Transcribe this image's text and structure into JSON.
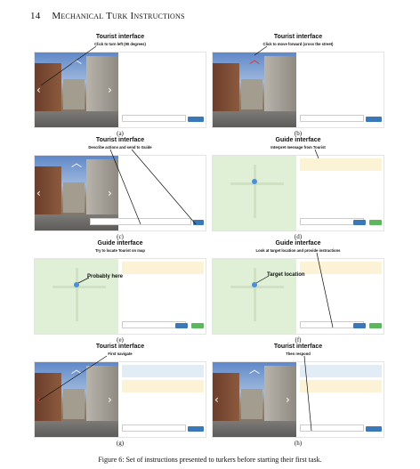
{
  "header": {
    "page_number": "14",
    "title": "Mechanical Turk Instructions"
  },
  "panels": [
    {
      "title": "Tourist interface",
      "subtitle": "Click to turn left (90 degrees)",
      "caption": "(a)"
    },
    {
      "title": "Tourist interface",
      "subtitle": "Click to move forward (cross the street)",
      "caption": "(b)"
    },
    {
      "title": "Tourist interface",
      "subtitle": "Describe actions and send to Guide",
      "caption": "(c)"
    },
    {
      "title": "Guide interface",
      "subtitle": "Interpret message from Tourist",
      "caption": "(d)"
    },
    {
      "title": "Guide interface",
      "subtitle": "Try to locate Tourist on map",
      "caption": "(e)",
      "note": "Probably here"
    },
    {
      "title": "Guide interface",
      "subtitle": "Look at target location and provide instructions",
      "caption": "(f)",
      "note": "Target location"
    },
    {
      "title": "Tourist interface",
      "subtitle": "First navigate",
      "caption": "(g)"
    },
    {
      "title": "Tourist interface",
      "subtitle": "Then respond",
      "caption": "(h)"
    }
  ],
  "figure_caption": "Figure 6: Set of instructions presented to turkers before starting their first task.",
  "colors": {
    "map_bg": "#dff0d7",
    "send_button": "#3a78b8",
    "evaluate_button": "#5cb85c",
    "guide_message_bg": "#fcf3d6",
    "tourist_message_bg": "#e2ecf5"
  },
  "icons": {
    "navigation": "chevron-icon",
    "map_marker": "location-pin-icon"
  }
}
